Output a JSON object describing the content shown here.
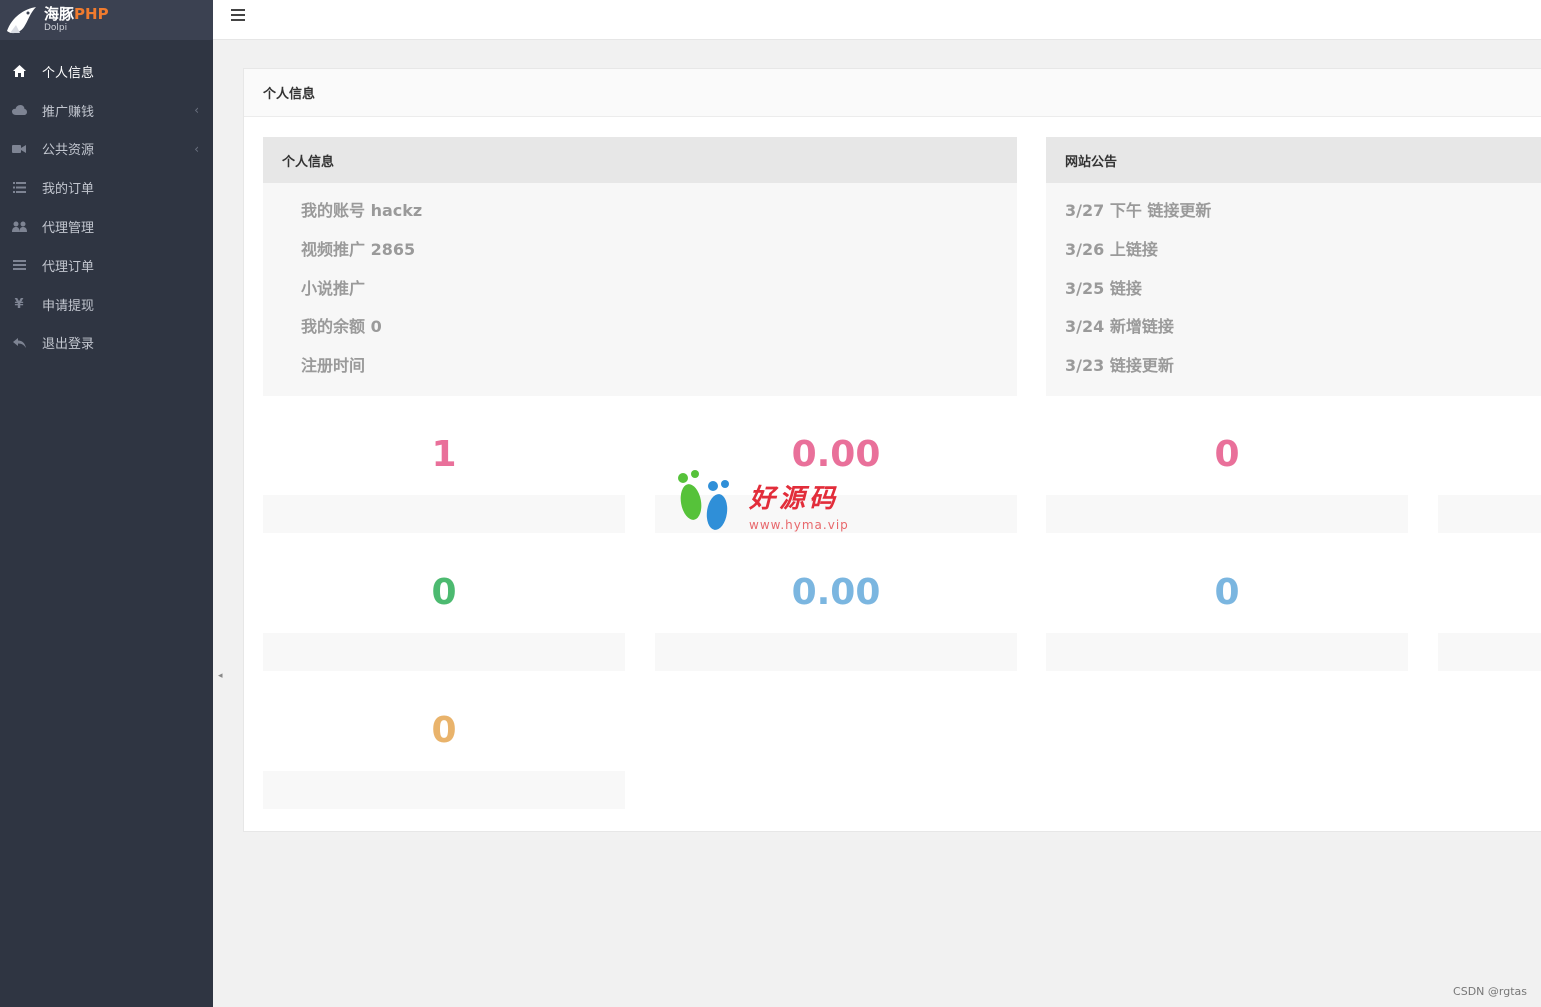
{
  "logo": {
    "title_main": "海豚",
    "title_accent": "PHP",
    "subtitle": "Dolpi"
  },
  "sidebar": {
    "items": [
      {
        "label": "个人信息",
        "icon": "home-icon",
        "active": true,
        "has_arrow": false
      },
      {
        "label": "推广赚钱",
        "icon": "cloud-icon",
        "active": false,
        "has_arrow": true
      },
      {
        "label": "公共资源",
        "icon": "video-camera-icon",
        "active": false,
        "has_arrow": true
      },
      {
        "label": "我的订单",
        "icon": "list-icon",
        "active": false,
        "has_arrow": false
      },
      {
        "label": "代理管理",
        "icon": "users-icon",
        "active": false,
        "has_arrow": false
      },
      {
        "label": "代理订单",
        "icon": "menu-lines-icon",
        "active": false,
        "has_arrow": false
      },
      {
        "label": "申请提现",
        "icon": "yen-icon",
        "active": false,
        "has_arrow": false
      },
      {
        "label": "退出登录",
        "icon": "reply-arrow-icon",
        "active": false,
        "has_arrow": false
      }
    ]
  },
  "panel": {
    "title": "个人信息"
  },
  "info_box": {
    "title": "个人信息",
    "rows": [
      {
        "key": "我的账号",
        "value": "hackz"
      },
      {
        "key": "视频推广",
        "value": "2865"
      },
      {
        "key": "小说推广",
        "value": ""
      },
      {
        "key": "我的余额",
        "value": "0"
      },
      {
        "key": "注册时间",
        "value": ""
      }
    ]
  },
  "news_box": {
    "title": "网站公告",
    "rows": [
      {
        "text": "3/27 下午 链接更新"
      },
      {
        "text": "3/26 上链接"
      },
      {
        "text": "3/25 链接"
      },
      {
        "text": "3/24 新增链接"
      },
      {
        "text": "3/23 链接更新"
      }
    ]
  },
  "stats": [
    {
      "value": "1",
      "label": "",
      "color": "#e9709a"
    },
    {
      "value": "0.00",
      "label": "",
      "color": "#e9709a"
    },
    {
      "value": "0",
      "label": "",
      "color": "#e9709a"
    },
    {
      "value": "0",
      "label": "",
      "color": "#4cba70"
    },
    {
      "value": "0.00",
      "label": "",
      "color": "#7bb6e0"
    },
    {
      "value": "0",
      "label": "",
      "color": "#7bb6e0"
    },
    {
      "value": "0",
      "label": "",
      "color": "#e9b36b"
    }
  ],
  "watermark": {
    "text": "好源码",
    "url": "www.hyma.vip"
  },
  "footer": {
    "credit": "CSDN @rgtas"
  }
}
